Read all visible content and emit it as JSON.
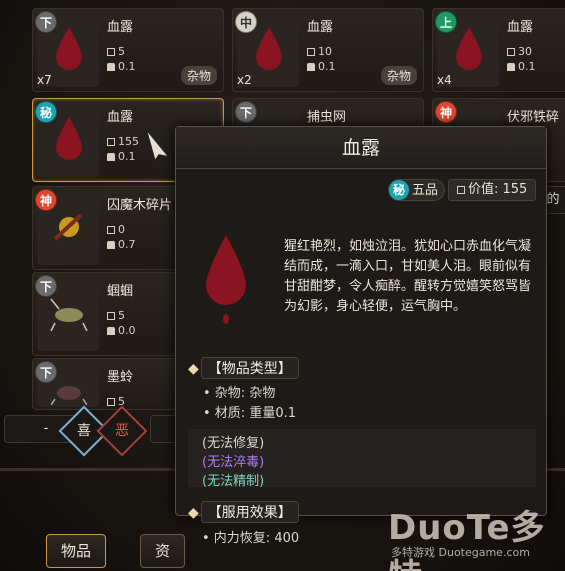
{
  "grid": [
    {
      "grade": "下",
      "grade_color": "#6b6b6b",
      "count": "x7",
      "name": "血露",
      "value": "5",
      "weight": "0.1",
      "tag": "杂物",
      "selected": false
    },
    {
      "grade": "中",
      "grade_color": "#d7d2c7",
      "count": "x2",
      "name": "血露",
      "value": "10",
      "weight": "0.1",
      "tag": "杂物",
      "selected": false
    },
    {
      "grade": "上",
      "grade_color": "#1f9a62",
      "count": "x4",
      "name": "血露",
      "value": "30",
      "weight": "0.1",
      "tag": "",
      "selected": false
    },
    {
      "grade": "秘",
      "grade_color": "#1aa5b3",
      "count": "",
      "name": "血露",
      "value": "155",
      "weight": "0.1",
      "tag": "",
      "selected": true
    },
    {
      "grade": "下",
      "grade_color": "#6b6b6b",
      "count": "",
      "name": "捕虫网",
      "value": "",
      "weight": "",
      "tag": "",
      "selected": false
    },
    {
      "grade": "神",
      "grade_color": "#e2452e",
      "count": "",
      "name": "伏邪铁碎",
      "value": "",
      "weight": "",
      "tag": "",
      "selected": false
    },
    {
      "grade": "神",
      "grade_color": "#e2452e",
      "count": "",
      "name": "囚魔木碎片",
      "value": "0",
      "weight": "0.7",
      "tag": "",
      "selected": false
    },
    {
      "grade": "下",
      "grade_color": "#6b6b6b",
      "count": "",
      "name": "蝈蝈",
      "value": "5",
      "weight": "0.0",
      "tag": "",
      "selected": false
    },
    {
      "grade": "下",
      "grade_color": "#6b6b6b",
      "count": "",
      "name": "墨蛉",
      "value": "5",
      "weight": "",
      "tag": "",
      "selected": false
    }
  ],
  "controls": {
    "minus_label": "-",
    "like_label": "喜",
    "dislike_label": "恶",
    "tab_items": "物品",
    "tab_assets": "资"
  },
  "tooltip": {
    "title": "血露",
    "grade_badge": "秘",
    "grade_text": "五品",
    "price_label": "价值: 155",
    "description": "猩红艳烈，如烛泣泪。犹如心口赤血化气凝结而成，一滴入口，甘如美人泪。眼前似有甘甜酣梦，令人痴醉。醒转方觉嬉笑怒骂皆为幻影，身心轻便，运气胸中。",
    "section_type": "【物品类型】",
    "type_line1": "• 杂物: 杂物",
    "type_line2": "• 材质: 重量0.1",
    "note_repair": "(无法修复)",
    "note_poison": "(无法淬毒)",
    "note_refine": "(无法精制)",
    "section_effect": "【服用效果】",
    "effect_line": "• 内力恢复: 400"
  },
  "watermark": {
    "logo": "DuoTe多特",
    "sub": "多特游戏 Duotegame.com"
  },
  "colors": {
    "accent_gold": "#c99a4c",
    "blood": "#8a1420",
    "purple_note": "#b07cf0",
    "teal_note": "#7fd3c4"
  }
}
